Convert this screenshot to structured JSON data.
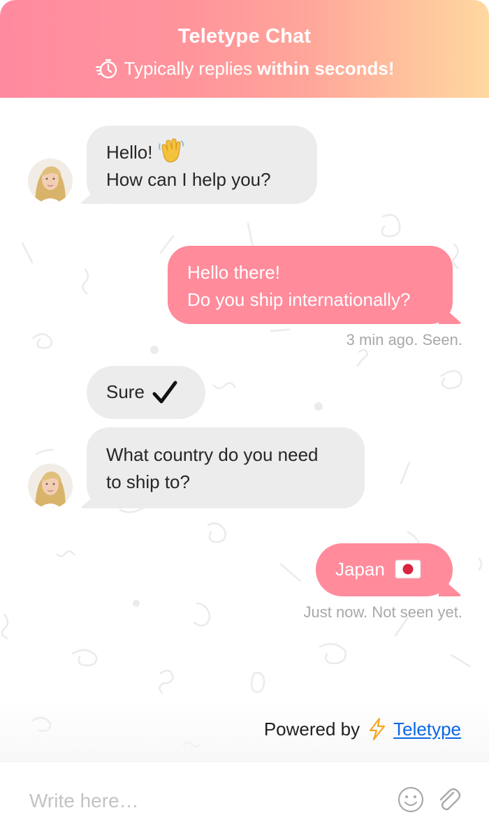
{
  "header": {
    "title": "Teletype Chat",
    "subtitle_prefix": "Typically replies",
    "subtitle_emphasis": "within seconds!",
    "gradient_colors": [
      "#ff8aa0",
      "#ffa59a",
      "#ffd8a0"
    ],
    "icon": "timer-icon"
  },
  "messages": [
    {
      "id": "msg-1",
      "from": "agent",
      "line1": "Hello!",
      "line1_emoji": "waving-hand",
      "line2": "How can I help you?"
    },
    {
      "id": "msg-2",
      "from": "user",
      "text": "Hello there!\nDo you ship internationally?",
      "meta": "3 min ago. Seen."
    },
    {
      "id": "msg-3",
      "from": "agent",
      "text": "Sure",
      "icon": "check-icon"
    },
    {
      "id": "msg-4",
      "from": "agent",
      "text": "What country do you need\nto ship to?"
    },
    {
      "id": "msg-5",
      "from": "user",
      "text": "Japan",
      "icon": "flag-japan-icon",
      "meta": "Just now. Not seen yet."
    }
  ],
  "footer": {
    "powered_by_label": "Powered by",
    "brand_link": "Teletype",
    "brand_icon": "lightning-icon"
  },
  "composer": {
    "placeholder": "Write here…",
    "emoji_button": "smiley-icon",
    "attach_button": "paperclip-icon"
  },
  "colors": {
    "accent": "#ff8b9b",
    "incoming_bubble": "#ececec",
    "link": "#0a66e8",
    "meta_text": "#a8a8a8"
  }
}
